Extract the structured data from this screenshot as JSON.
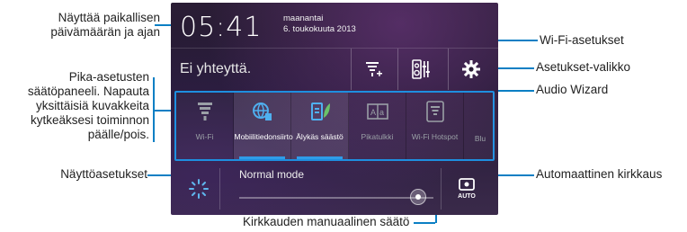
{
  "annotations": {
    "date_time": "Näyttää paikallisen\npäivämäärän ja ajan",
    "quick_settings": "Pika-asetusten\nsäätöpaneeli. Napauta\nyksittäisiä kuvakkeita\nkytkeäksesi toiminnon\npäälle/pois.",
    "display_settings": "Näyttöasetukset",
    "wifi_settings": "Wi-Fi-asetukset",
    "settings_menu": "Asetukset-valikko",
    "audio_wizard": "Audio Wizard",
    "auto_brightness": "Automaattinen kirkkaus",
    "manual_brightness": "Kirkkauden manuaalinen säätö"
  },
  "status": {
    "time": "05:41",
    "day": "maanantai",
    "date": "6. toukokuuta 2013",
    "network": "Ei yhteyttä."
  },
  "tiles": [
    {
      "label": "Wi-Fi",
      "icon": "wifi-icon",
      "active": false
    },
    {
      "label": "Mobiilitiedonsiirto",
      "icon": "mobile-data-icon",
      "active": true
    },
    {
      "label": "Älykäs säästö",
      "icon": "smart-saving-icon",
      "active": true
    },
    {
      "label": "Pikatulkki",
      "icon": "instant-dictionary-icon",
      "active": false
    },
    {
      "label": "Wi-Fi Hotspot",
      "icon": "wifi-hotspot-icon",
      "active": false
    },
    {
      "label": "Blu",
      "icon": "bluetooth-icon",
      "active": false
    }
  ],
  "brightness": {
    "mode": "Normal mode",
    "level": 0.92,
    "auto_icon_text": "AUTO"
  },
  "colors": {
    "accent": "#0b7fc4",
    "highlight": "#1e8fe0"
  }
}
